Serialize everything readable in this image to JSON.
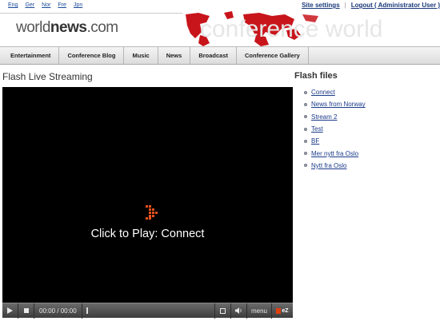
{
  "header": {
    "languages": [
      "Eng",
      "Ger",
      "Nor",
      "Fre",
      "Jpn"
    ],
    "logo_prefix": "world",
    "logo_bold": "news",
    "logo_suffix": ".com",
    "watermark": "conference world",
    "links": {
      "site_settings": "Site settings",
      "logout": "Logout ( Administrator User )"
    }
  },
  "nav": {
    "items": [
      "Entertainment",
      "Conference Blog",
      "Music",
      "News",
      "Broadcast",
      "Conference Gallery"
    ]
  },
  "main": {
    "title": "Flash Live Streaming",
    "player": {
      "play_text": "Click to Play: Connect",
      "time": "00:00 / 00:00",
      "menu_label": "menu",
      "ez_label": "eZ"
    }
  },
  "sidebar": {
    "title": "Flash files",
    "items": [
      "Connect",
      "News from Norway",
      "Stream 2",
      "Test",
      "BF",
      "Mer nytt fra Oslo",
      "Nytt fra Oslo"
    ]
  },
  "colors": {
    "link": "#1a3a8a",
    "map_red": "#c8151b",
    "player_bg": "#000000",
    "accent_orange": "#e04010"
  }
}
